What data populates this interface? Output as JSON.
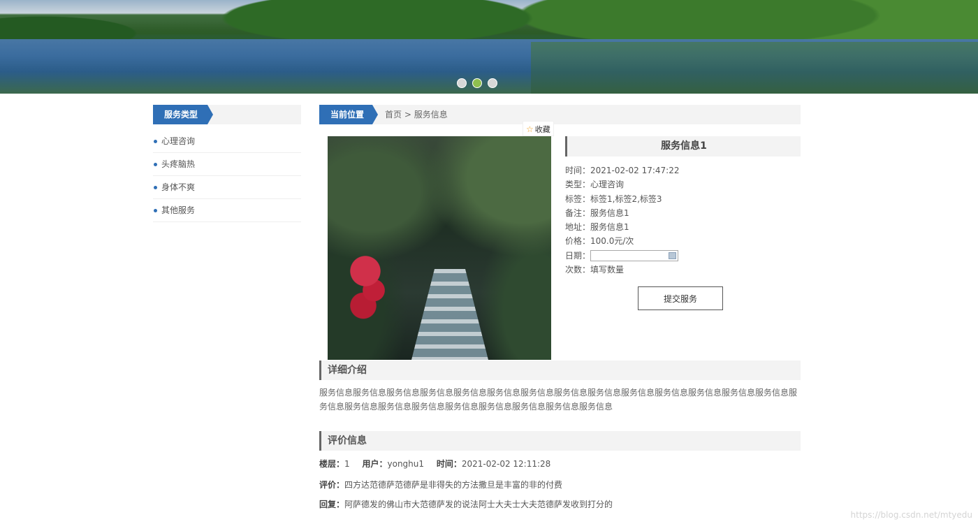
{
  "banner": {
    "dots": [
      {
        "label": "slide 1",
        "active": false
      },
      {
        "label": "slide 2",
        "active": true
      },
      {
        "label": "slide 3",
        "active": false
      }
    ]
  },
  "sidebar": {
    "title": "服务类型",
    "items": [
      {
        "label": "心理咨询"
      },
      {
        "label": "头疼脑热"
      },
      {
        "label": "身体不爽"
      },
      {
        "label": "其他服务"
      }
    ]
  },
  "location": {
    "title": "当前位置",
    "home": "首页",
    "separator": ">",
    "current": "服务信息"
  },
  "favorite": {
    "label": "收藏"
  },
  "service": {
    "title": "服务信息1",
    "time_label": "时间：",
    "time": "2021-02-02 17:47:22",
    "type_label": "类型：",
    "type": "心理咨询",
    "tags_label": "标签：",
    "tags": "标签1,标签2,标签3",
    "note_label": "备注：",
    "note": "服务信息1",
    "address_label": "地址：",
    "address": "服务信息1",
    "price_label": "价格：",
    "price": "100.0元/次",
    "date_label": "日期：",
    "date_value": "",
    "count_label": "次数：",
    "count_placeholder": "填写数量",
    "submit_label": "提交服务"
  },
  "detail": {
    "title": "详细介绍",
    "text": "服务信息服务信息服务信息服务信息服务信息服务信息服务信息服务信息服务信息服务信息服务信息服务信息服务信息服务信息服务信息服务信息服务信息服务信息服务信息服务信息服务信息服务信息服务信息"
  },
  "reviews": {
    "title": "评价信息",
    "floor_label": "楼层：",
    "floor": "1",
    "user_label": "用户：",
    "user": "yonghu1",
    "time_label": "时间：",
    "time": "2021-02-02 12:11:28",
    "comment_label": "评价：",
    "comment": "四方达范德萨范德萨是非得失的方法撒旦是丰富的非的付费",
    "reply_label": "回复：",
    "reply": "阿萨德发的佛山市大范德萨发的说法阿士大夫士大夫范德萨发收到打分的"
  },
  "watermark": "https://blog.csdn.net/mtyedu"
}
